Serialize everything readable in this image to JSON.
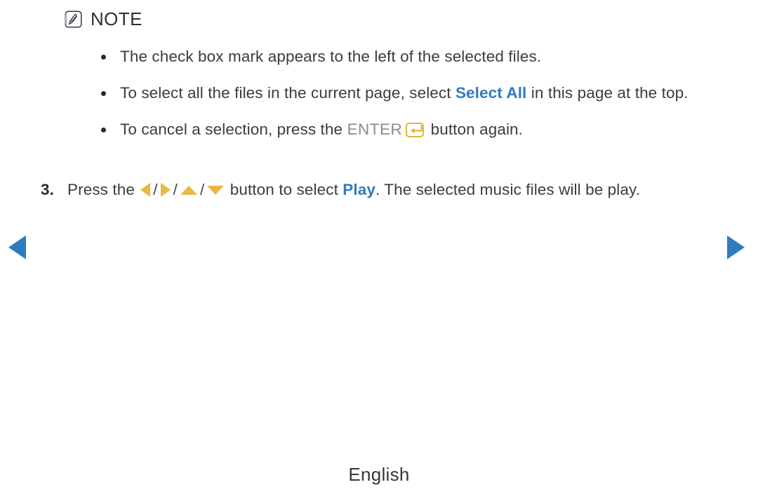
{
  "page": {
    "background_color": "#ffffff",
    "footer_language": "English"
  },
  "note": {
    "icon": "note-pen-icon",
    "label": "NOTE",
    "bullets": [
      {
        "id": "bullet-checkbox-mark",
        "segments": [
          {
            "type": "text",
            "value": "The check box mark appears to the left of the selected files."
          }
        ]
      },
      {
        "id": "bullet-select-all",
        "segments": [
          {
            "type": "text",
            "value": "To select all the files in the current page, select "
          },
          {
            "type": "keyword-blue",
            "value": "Select All"
          },
          {
            "type": "text",
            "value": " in this page at the top."
          }
        ]
      },
      {
        "id": "bullet-cancel-selection",
        "segments": [
          {
            "type": "text",
            "value": "To cancel a selection, press the "
          },
          {
            "type": "keyword-gray",
            "value": "ENTER"
          },
          {
            "type": "icon",
            "value": "enter-key-icon"
          },
          {
            "type": "text",
            "value": " button again."
          }
        ]
      }
    ]
  },
  "steps": [
    {
      "id": "step-3",
      "number": "3.",
      "segments": [
        {
          "type": "text",
          "value": "Press the "
        },
        {
          "type": "icon",
          "value": "arrow-left-icon"
        },
        {
          "type": "separator",
          "value": "/"
        },
        {
          "type": "icon",
          "value": "arrow-right-icon"
        },
        {
          "type": "separator",
          "value": "/"
        },
        {
          "type": "icon",
          "value": "arrow-up-icon"
        },
        {
          "type": "separator",
          "value": "/"
        },
        {
          "type": "icon",
          "value": "arrow-down-icon"
        },
        {
          "type": "text",
          "value": " button to select "
        },
        {
          "type": "keyword-blue",
          "value": "Play"
        },
        {
          "type": "text",
          "value": ". The selected music files will be play."
        }
      ]
    }
  ],
  "navigation": {
    "prev_label": "previous-page",
    "next_label": "next-page"
  },
  "inline_text": {
    "bullet1_text": "The check box mark appears to the left of the selected files.",
    "bullet2_before": "To select all the files in the current page, select ",
    "bullet2_keyword": "Select All",
    "bullet2_after": " in this page at the top.",
    "bullet3_before": "To cancel a selection, press the ",
    "bullet3_keyword": "ENTER",
    "bullet3_after": " button again.",
    "step3_number": "3.",
    "step3_before": "Press the ",
    "step3_slash1": "/",
    "step3_slash2": "/",
    "step3_slash3": "/",
    "step3_middle": " button to select ",
    "step3_keyword": "Play",
    "step3_after": ". The selected music files will be play."
  },
  "colors": {
    "keyword_blue": "#2e7bc0",
    "keyword_gray": "#8c8c8c",
    "accent_gold": "#e8b944",
    "enter_border": "#e3b53f",
    "nav_blue": "#2e7bc0",
    "body_text": "#3c3c3c"
  }
}
